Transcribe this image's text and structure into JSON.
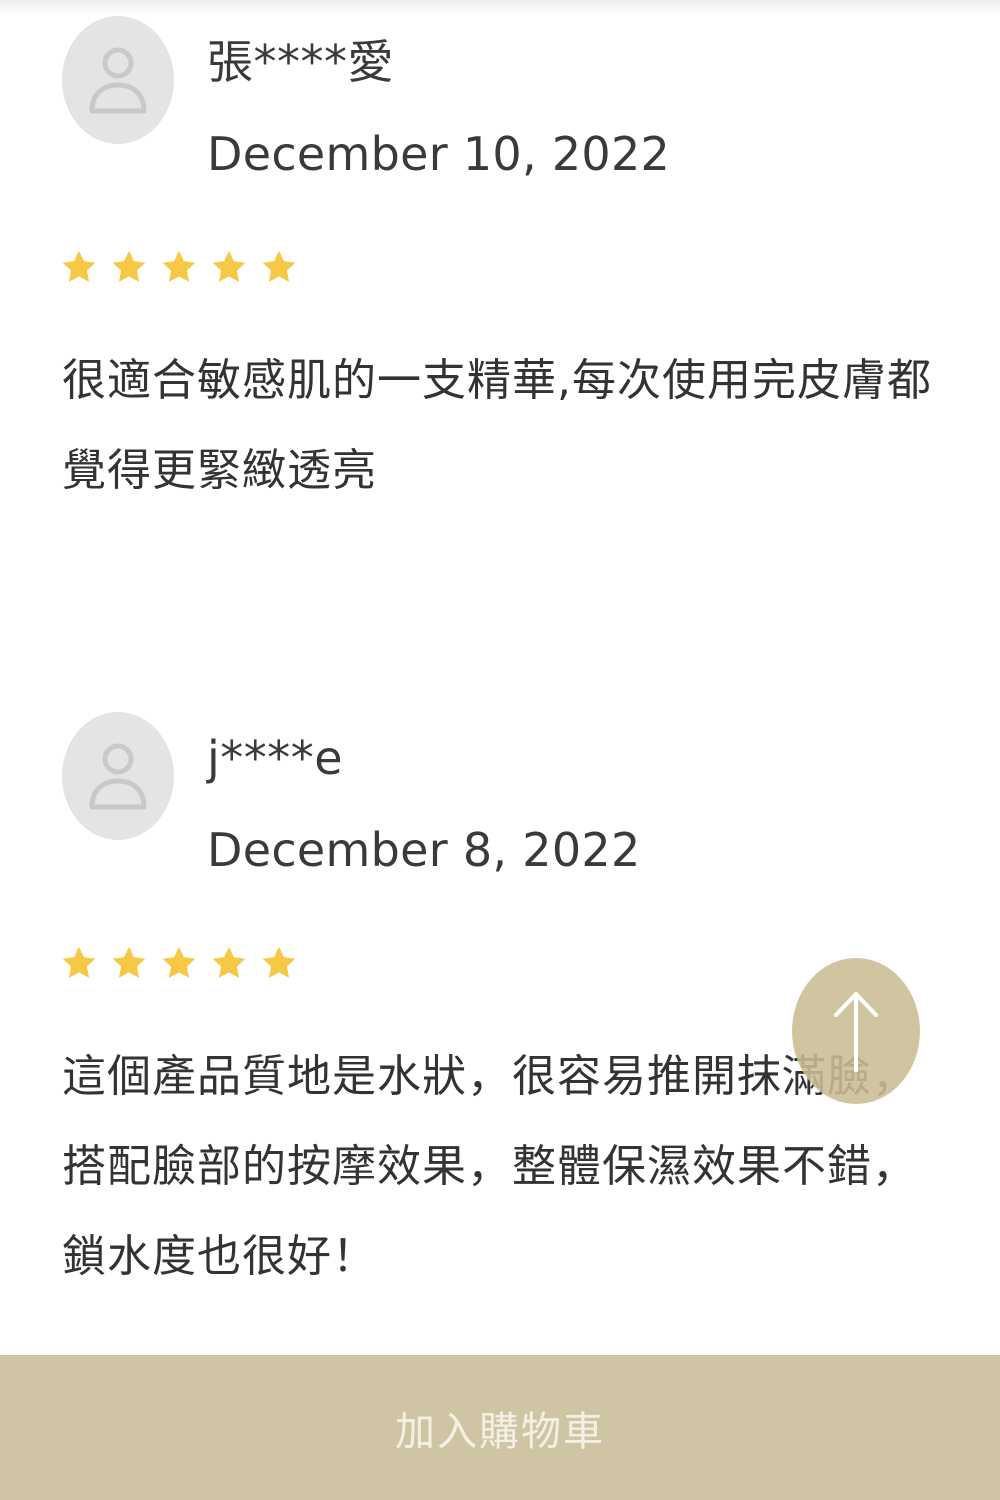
{
  "reviews": [
    {
      "name": "張****愛",
      "date": "December 10, 2022",
      "rating": 5,
      "text": "很適合敏感肌的一支精華,每次使用完皮膚都覺得更緊緻透亮"
    },
    {
      "name": "j****e",
      "date": "December 8, 2022",
      "rating": 5,
      "text": "這個產品質地是水狀，很容易推開抹滿臉，搭配臉部的按摩效果，整體保濕效果不錯，鎖水度也很好！"
    }
  ],
  "icons": {
    "avatar": "user-silhouette-icon",
    "star": "star-icon",
    "scroll_top": "arrow-up-icon"
  },
  "colors": {
    "star": "#f7c843",
    "avatar_bg": "#e4e4e4",
    "avatar_icon": "#c9c9c9",
    "scroll_top_bg": "#c9bc94",
    "cart_bar_bg": "#cfc5a4",
    "cart_label": "#f4f0e4"
  },
  "cart_button": {
    "label": "加入購物車"
  }
}
